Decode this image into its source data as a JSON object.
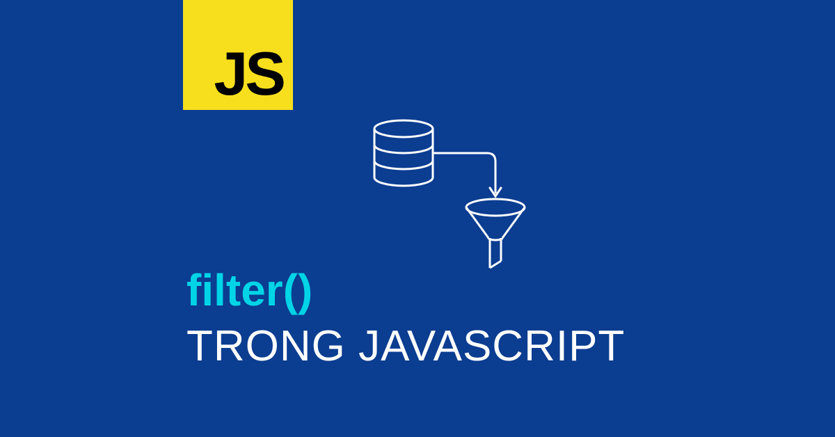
{
  "logo": {
    "text": "JS",
    "background_color": "#f7df1e",
    "text_color": "#000000"
  },
  "heading": {
    "filter_text": "filter()",
    "filter_color": "#00d4e6",
    "subtitle": "TRONG JAVASCRIPT",
    "subtitle_color": "#ffffff"
  },
  "background_color": "#0b3d91",
  "diagram": {
    "description": "database-to-funnel-filter",
    "stroke_color": "#ffffff"
  }
}
